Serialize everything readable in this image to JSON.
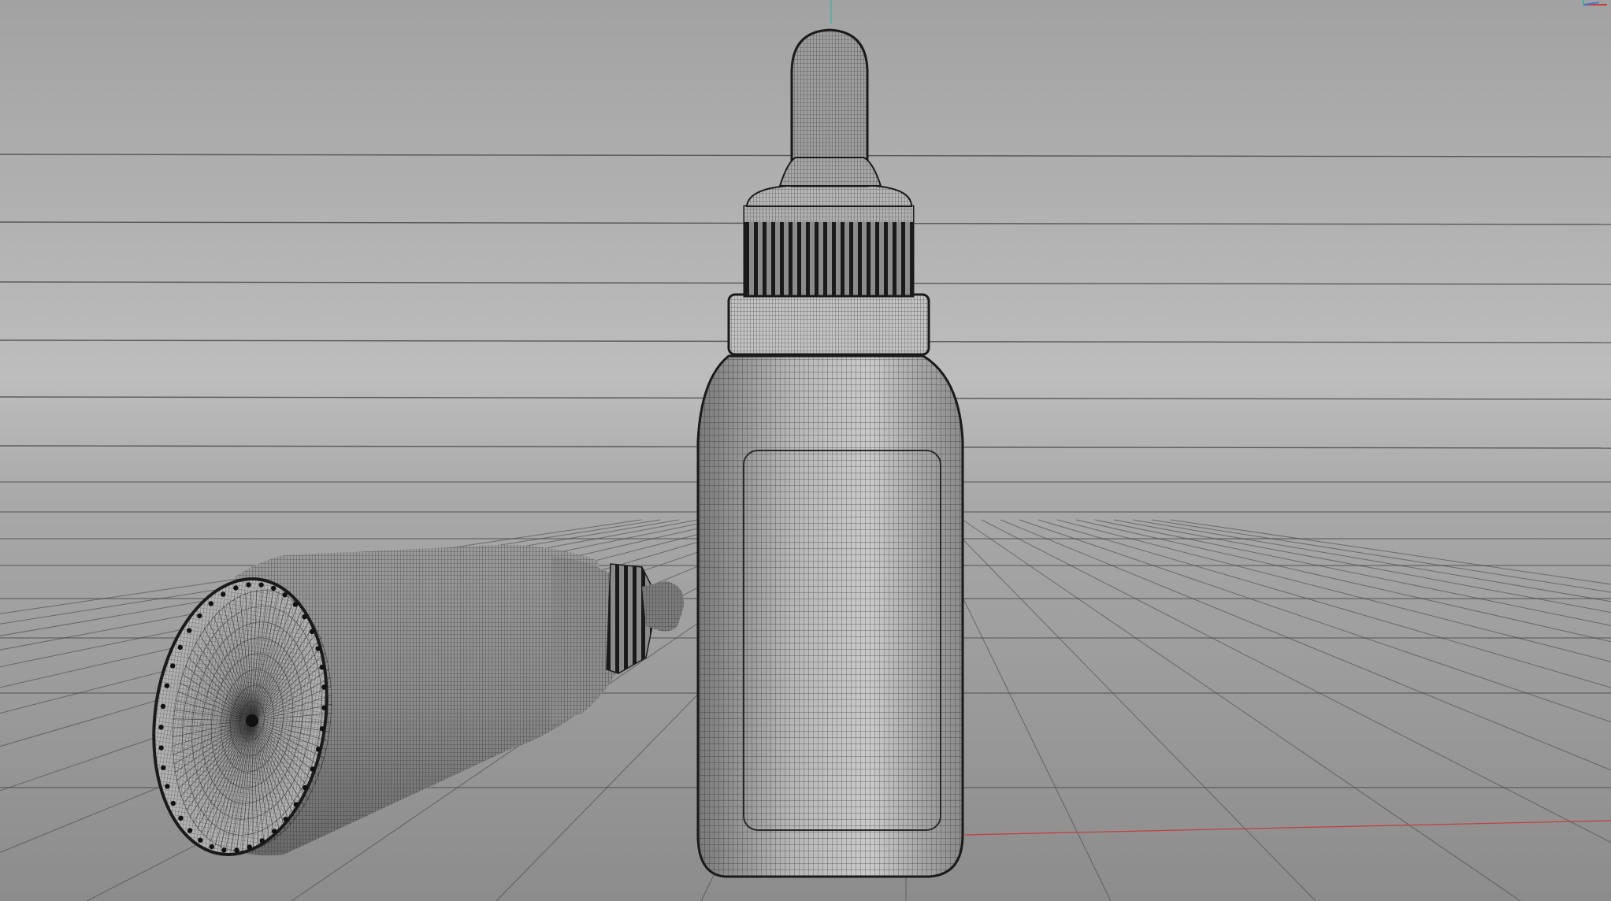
{
  "viewport": {
    "background_top": "#a3a3a3",
    "background_mid": "#bcbcbc",
    "background_bottom": "#8f8f8f",
    "grid_line_color": "#3a3a3a",
    "x_axis_color": "#c43c3c",
    "y_axis_color": "#3cb4a0",
    "wire_color": "#1e1e1e",
    "surface_color": "#a9a9a9"
  },
  "scene": {
    "objects": [
      {
        "name": "dropper-bottle-standing",
        "orientation": "upright"
      },
      {
        "name": "dropper-bottle-lying",
        "orientation": "on-side"
      }
    ]
  },
  "overlay": {
    "axis_gizmo_icon": "axis-gizmo-icon"
  }
}
